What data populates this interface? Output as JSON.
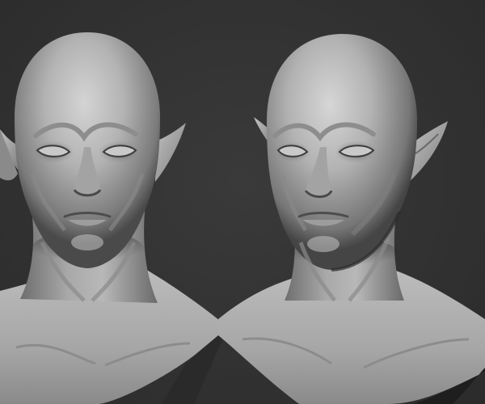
{
  "scene": {
    "background_color": "#333333",
    "material_color": "#b8b8b8",
    "shadow_color": "#1c1c1c",
    "views": [
      {
        "name": "front-view"
      },
      {
        "name": "three-quarter-view"
      }
    ]
  }
}
